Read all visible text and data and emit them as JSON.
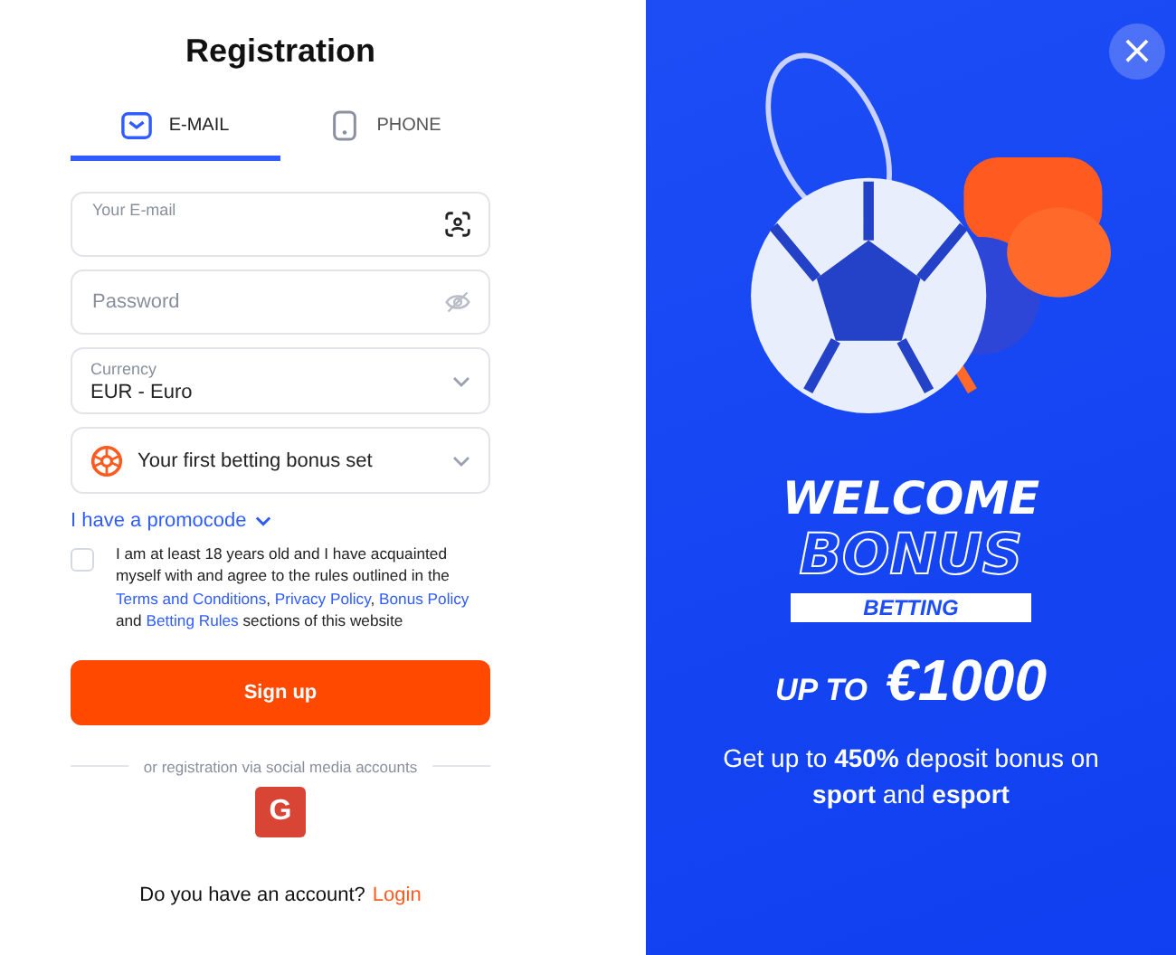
{
  "title": "Registration",
  "tabs": [
    {
      "label": "E-MAIL",
      "kind": "email",
      "selected": true
    },
    {
      "label": "PHONE",
      "kind": "phone",
      "selected": false
    }
  ],
  "fields": [
    {
      "kind": "email",
      "placeholder": "Your E-mail"
    },
    {
      "kind": "password",
      "placeholder": "Password"
    },
    {
      "kind": "select",
      "label": "Currency",
      "value": "EUR - Euro"
    },
    {
      "kind": "bonus",
      "value": "Your first betting bonus set"
    }
  ],
  "promocode": "I have a promocode",
  "agreement": {
    "checked": false,
    "parts": [
      {
        "text": "I am at least 18 years old and I have acquainted myself with and agree to the rules outlined in the ",
        "link": false
      },
      {
        "text": "Terms and Conditions",
        "link": true
      },
      {
        "text": ", ",
        "link": false
      },
      {
        "text": "Privacy Policy",
        "link": true
      },
      {
        "text": ", ",
        "link": false
      },
      {
        "text": "Bonus Policy",
        "link": true
      },
      {
        "text": " and ",
        "link": false
      },
      {
        "text": "Betting Rules",
        "link": true
      },
      {
        "text": " sections of this website",
        "link": false
      }
    ]
  },
  "signup_button": "Sign up",
  "social_divider": "or registration via social media accounts",
  "social_buttons": [
    {
      "label": "G"
    }
  ],
  "login_prompt": "Do you have an account?",
  "login_link": "Login",
  "promo": {
    "welcome": "WELCOME",
    "bonus": "BONUS",
    "tag": "BETTING",
    "up_to": "UP TO",
    "amount": "€1000",
    "description": "Get up to **450%** deposit bonus on **sport** and **esport**"
  },
  "close_button": "×"
}
